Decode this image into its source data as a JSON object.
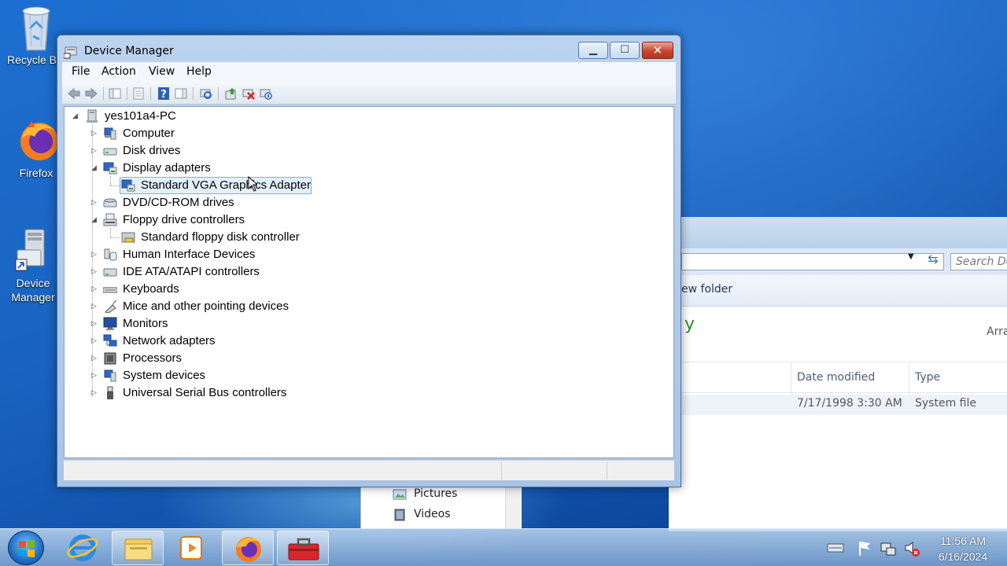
{
  "desktop": {
    "icons": [
      {
        "label": "Recycle B",
        "icon": "recycle-bin-icon"
      },
      {
        "label": "Firefox",
        "icon": "firefox-icon"
      },
      {
        "label": "Device\nManager",
        "line1": "Device",
        "line2": "Manager",
        "icon": "device-manager-icon"
      }
    ]
  },
  "background_window": {
    "search_placeholder": "Search Do",
    "command": "ew folder",
    "library_fragment": "y",
    "arrange_fragment": "Arra",
    "columns": {
      "date_modified": "Date modified",
      "type": "Type"
    },
    "row": {
      "date": "7/17/1998 3:30 AM",
      "type": "System file"
    },
    "nav": [
      {
        "label": "Pictures"
      },
      {
        "label": "Videos"
      }
    ]
  },
  "window": {
    "title": "Device Manager",
    "menu": [
      "File",
      "Action",
      "View",
      "Help"
    ]
  },
  "tree": {
    "root": "yes101a4-PC",
    "nodes": [
      {
        "label": "Computer",
        "expanded": false
      },
      {
        "label": "Disk drives",
        "expanded": false
      },
      {
        "label": "Display adapters",
        "expanded": true
      },
      {
        "label": "Standard VGA Graphics Adapter",
        "child": true,
        "selected": true
      },
      {
        "label": "DVD/CD-ROM drives",
        "expanded": false
      },
      {
        "label": "Floppy drive controllers",
        "expanded": true
      },
      {
        "label": "Standard floppy disk controller",
        "child": true
      },
      {
        "label": "Human Interface Devices",
        "expanded": false
      },
      {
        "label": "IDE ATA/ATAPI controllers",
        "expanded": false
      },
      {
        "label": "Keyboards",
        "expanded": false
      },
      {
        "label": "Mice and other pointing devices",
        "expanded": false
      },
      {
        "label": "Monitors",
        "expanded": false
      },
      {
        "label": "Network adapters",
        "expanded": false
      },
      {
        "label": "Processors",
        "expanded": false
      },
      {
        "label": "System devices",
        "expanded": false
      },
      {
        "label": "Universal Serial Bus controllers",
        "expanded": false
      }
    ]
  },
  "taskbar": {
    "apps": [
      "internet-explorer-icon",
      "explorer-icon",
      "media-player-icon",
      "firefox-icon",
      "toolbox-icon"
    ],
    "clock": {
      "time": "11:56 AM",
      "date": "6/16/2024"
    }
  }
}
